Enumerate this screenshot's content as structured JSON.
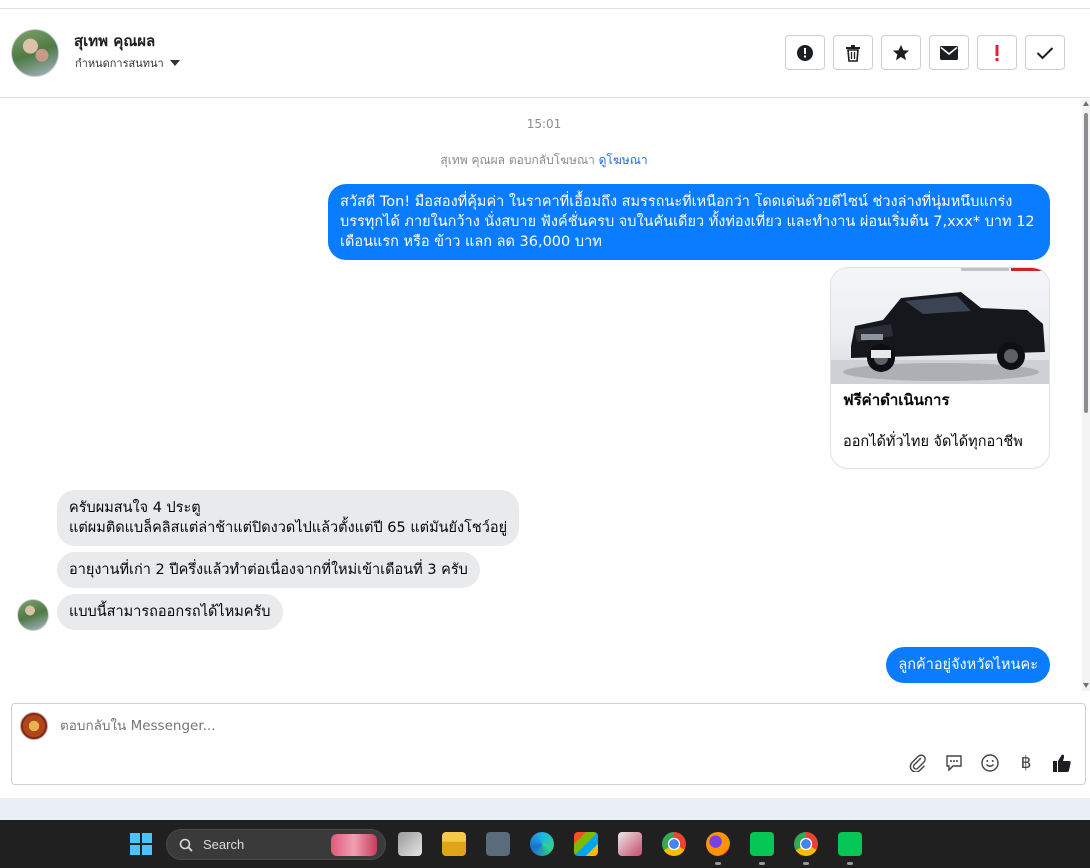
{
  "header": {
    "contact_name": "สุเทพ คุณผล",
    "assign_label": "กำหนดการสนทนา",
    "actions": [
      "report",
      "delete",
      "star",
      "mark-unread",
      "important",
      "done"
    ]
  },
  "conversation": {
    "timestamp": "15:01",
    "reply_note_prefix": "สุเทพ คุณผล ตอบกลับโฆษณา",
    "reply_note_link": "ดูโฆษณา",
    "ad_message": "สวัสดี Ton! มือสองที่คุ้มค่า ในราคาที่เอื้อมถึง สมรรถนะที่เหนือกว่า โดดเด่นด้วยดีไซน์ ช่วงล่างที่นุ่มหนึบแกร่ง บรรทุกได้ ภายในกว้าง นั่งสบาย ฟังค์ชั่นครบ จบในคันเดียว ทั้งท่องเที่ยว และทำงาน ผ่อนเริ่มต้น 7,xxx* บาท 12 เดือนแรก หรือ ข้าว แลก ลด 36,000 บาท",
    "card": {
      "title": "ฟรีค่าดำเนินการ",
      "description": "ออกได้ทั่วไทย จัดได้ทุกอาชีพ"
    },
    "incoming": {
      "msg1_line1": "ครับผมสนใจ 4 ประตู",
      "msg1_line2": "แต่ผมติดแบล็คลิสแต่ล่าช้าแต่ปิดงวดไปแล้วตั้งแต่ปี 65 แต่มันยังโชว์อยู่",
      "msg2": "อายุงานที่เก่า 2 ปีครึ่งแล้วทำต่อเนื่องจากที่ใหม่เข้าเดือนที่ 3 ครับ",
      "msg3": "แบบนี้สามารถออกรถได้ไหมครับ"
    },
    "outgoing_reply": "ลูกค้าอยู่จังหวัดไหนคะ"
  },
  "composer": {
    "placeholder": "ตอบกลับใน Messenger...",
    "tools": [
      "attach-icon",
      "saved-reply-icon",
      "emoji-icon",
      "baht-icon",
      "like-icon"
    ],
    "baht_symbol": "฿"
  },
  "taskbar": {
    "search_label": "Search"
  },
  "colors": {
    "outgoing_bubble": "#0a7cff",
    "incoming_bubble": "#e9eaec",
    "link": "#216fdb",
    "important": "#e41e3f"
  }
}
